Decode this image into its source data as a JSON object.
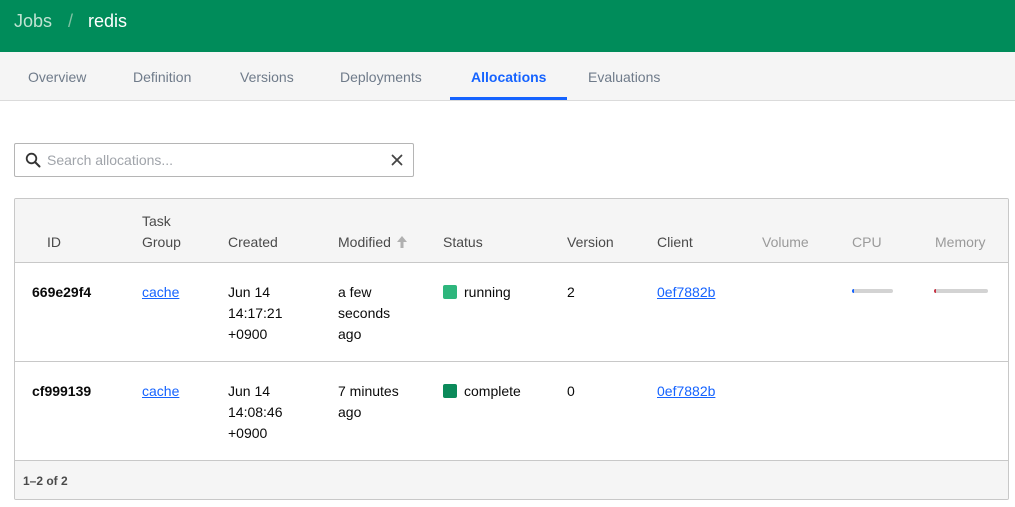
{
  "breadcrumb": {
    "root": "Jobs",
    "separator": "/",
    "job": "redis"
  },
  "tabs": [
    "Overview",
    "Definition",
    "Versions",
    "Deployments",
    "Allocations",
    "Evaluations"
  ],
  "active_tab": "Allocations",
  "search": {
    "placeholder": "Search allocations...",
    "value": ""
  },
  "table": {
    "headers": {
      "id": "ID",
      "task_group_1": "Task",
      "task_group_2": "Group",
      "created": "Created",
      "modified": "Modified",
      "status": "Status",
      "version": "Version",
      "client": "Client",
      "volume": "Volume",
      "cpu": "CPU",
      "memory": "Memory"
    },
    "sort": {
      "column": "Modified",
      "direction": "ascending"
    },
    "rows": [
      {
        "id": "669e29f4",
        "task_group": "cache",
        "created_1": "Jun 14",
        "created_2": "14:17:21",
        "created_3": "+0900",
        "modified_1": "a few",
        "modified_2": "seconds",
        "modified_3": "ago",
        "status": "running",
        "status_color": "#2eb67d",
        "version": "2",
        "client": "0ef7882b",
        "cpu_usage": 0.02,
        "memory_usage": 0.03
      },
      {
        "id": "cf999139",
        "task_group": "cache",
        "created_1": "Jun 14",
        "created_2": "14:08:46",
        "created_3": "+0900",
        "modified_1": "7 minutes",
        "modified_2": "ago",
        "status": "complete",
        "status_color": "#0b8a5a",
        "version": "0",
        "client": "0ef7882b"
      }
    ],
    "pagination": "1–2 of 2"
  },
  "colors": {
    "header_bg": "#008c5a",
    "accent": "#1563ff",
    "cpu_fill": "#1563ff",
    "memory_fill": "#c73445"
  }
}
